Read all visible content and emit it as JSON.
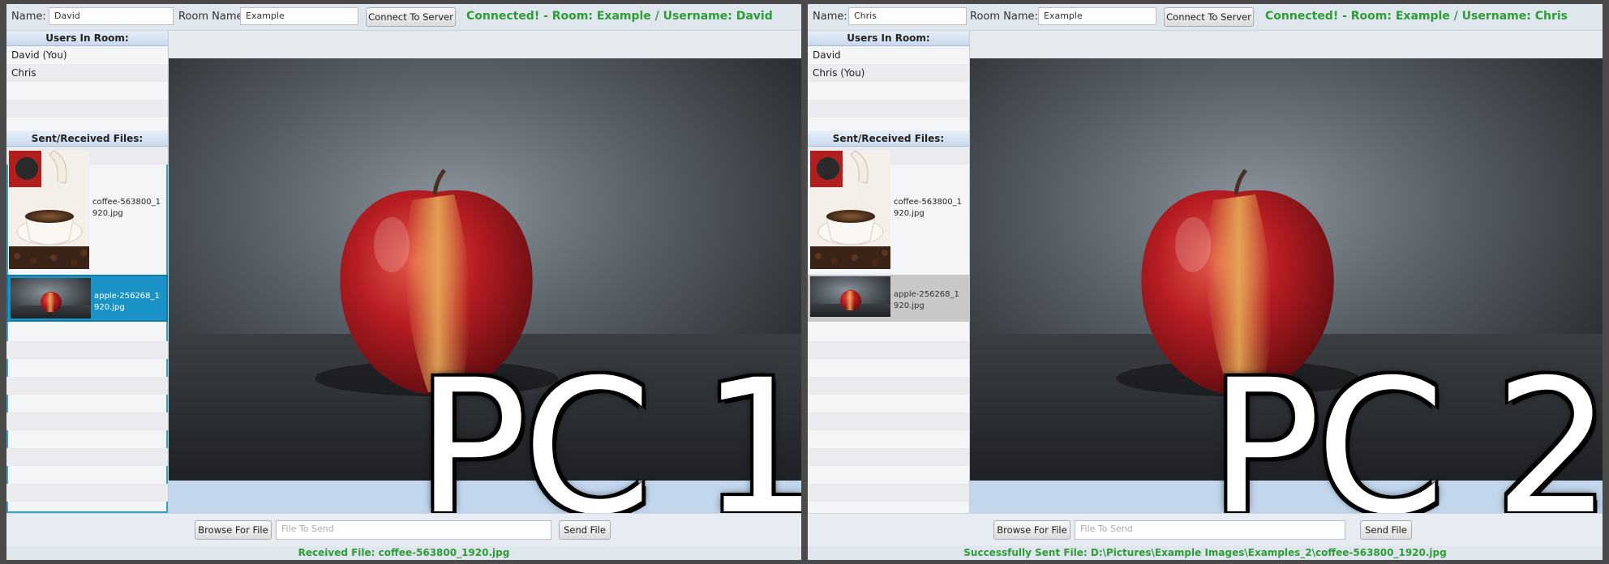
{
  "pcs": [
    {
      "name_label": "Name:",
      "name_value": "David",
      "room_label": "Room Name:",
      "room_value": "Example",
      "connect_label": "Connect To Server",
      "status": "Connected! - Room: Example / Username: David",
      "users_header": "Users In Room:",
      "users": [
        "David (You)",
        "Chris"
      ],
      "files_header": "Sent/Received Files:",
      "files": [
        {
          "name": "coffee-563800_1920.jpg",
          "thumb": "coffee"
        },
        {
          "name": "apple-256268_1920.jpg",
          "thumb": "apple",
          "selected": true
        }
      ],
      "overlay": "PC 1",
      "browse_label": "Browse For File",
      "file_placeholder": "File To Send",
      "send_label": "Send File",
      "footer": "Received File: coffee-563800_1920.jpg"
    },
    {
      "name_label": "Name:",
      "name_value": "Chris",
      "room_label": "Room Name:",
      "room_value": "Example",
      "connect_label": "Connect To Server",
      "status": "Connected! - Room: Example / Username: Chris",
      "users_header": "Users In Room:",
      "users": [
        "David",
        "Chris (You)"
      ],
      "files_header": "Sent/Received Files:",
      "files": [
        {
          "name": "coffee-563800_1920.jpg",
          "thumb": "coffee"
        },
        {
          "name": "apple-256268_1920.jpg",
          "thumb": "apple",
          "selected": false
        }
      ],
      "overlay": "PC 2",
      "browse_label": "Browse For File",
      "file_placeholder": "File To Send",
      "send_label": "Send File",
      "footer": "Successfully Sent File: D:\\Pictures\\Example Images\\Examples_2\\coffee-563800_1920.jpg"
    }
  ],
  "colors": {
    "status_green": "#2e9d36",
    "selection_blue": "#1a94c6",
    "header_blue": "#c9daee"
  }
}
